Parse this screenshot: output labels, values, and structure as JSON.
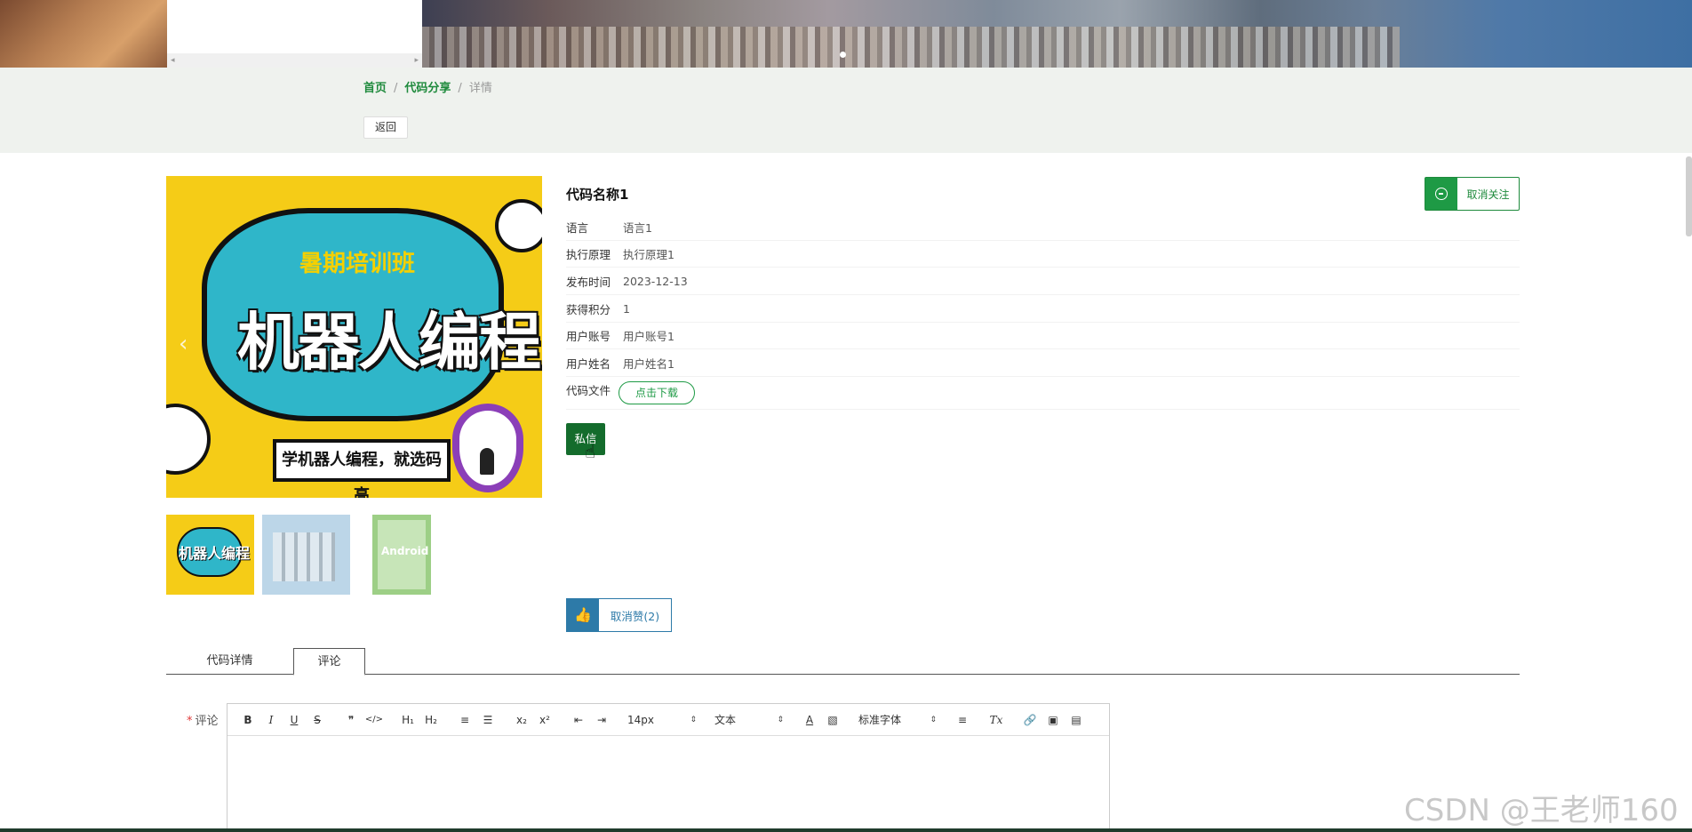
{
  "breadcrumb": {
    "home": "首页",
    "section": "代码分享",
    "current": "详情",
    "separator": "/"
  },
  "back_label": "返回",
  "main_image": {
    "subtitle": "暑期培训班",
    "title": "机器人编程",
    "tagline": "学机器人编程，就选码高",
    "prev_arrow": "‹",
    "next_arrow": "›"
  },
  "thumbnails": [
    {
      "text": "机器人编程"
    },
    {
      "text": ""
    },
    {
      "text": "Android"
    }
  ],
  "item": {
    "title": "代码名称1",
    "follow_label": "取消关注",
    "fields": [
      {
        "label": "语言",
        "value": "语言1"
      },
      {
        "label": "执行原理",
        "value": "执行原理1"
      },
      {
        "label": "发布时间",
        "value": "2023-12-13"
      },
      {
        "label": "获得积分",
        "value": "1"
      },
      {
        "label": "用户账号",
        "value": "用户账号1"
      },
      {
        "label": "用户姓名",
        "value": "用户姓名1"
      }
    ],
    "file_label": "代码文件",
    "download_label": "点击下载",
    "message_label": "私信",
    "like_label": "取消赞(2)"
  },
  "tabs": [
    {
      "label": "代码详情"
    },
    {
      "label": "评论"
    }
  ],
  "comment": {
    "label": "评论",
    "required_mark": "*",
    "toolbar": {
      "bold": "B",
      "italic": "I",
      "underline": "U",
      "strike": "S",
      "quote": "❞",
      "code": "</>",
      "h1": "H₁",
      "h2": "H₂",
      "ordered": "≡",
      "bullet": "☰",
      "sub": "x₂",
      "sup": "x²",
      "outdent": "⇤",
      "indent": "⇥",
      "size": "14px",
      "header": "文本",
      "font": "标准字体",
      "align": "≡",
      "clean": "Tx",
      "link": "🔗",
      "image": "▣",
      "video": "▤"
    }
  },
  "watermark": "CSDN @王老师160",
  "colors": {
    "primary_green": "#1e8a3c",
    "dark_green": "#146c2c",
    "like_blue": "#2d7aa8",
    "crumb_bg": "#eff2ee"
  }
}
